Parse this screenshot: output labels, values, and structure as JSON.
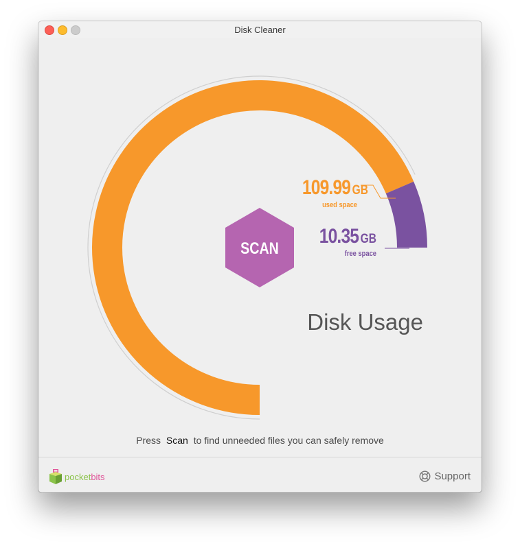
{
  "window": {
    "title": "Disk Cleaner"
  },
  "disk": {
    "used_value": "109.99",
    "used_unit": "GB",
    "used_caption": "used space",
    "free_value": "10.35",
    "free_unit": "GB",
    "free_caption": "free space",
    "used_fraction": 0.914
  },
  "scan_button": {
    "label": "SCAN"
  },
  "section_label": "Disk Usage",
  "hint": {
    "before": "Press",
    "keyword": "Scan",
    "after": "to find unneeded files you can safely remove"
  },
  "footer": {
    "brand_part1": "pocket",
    "brand_part2": "bits",
    "support_label": "Support"
  },
  "colors": {
    "used": "#f7982b",
    "free": "#7a52a0",
    "scan": "#b565b0",
    "track": "#cfcfcf"
  }
}
